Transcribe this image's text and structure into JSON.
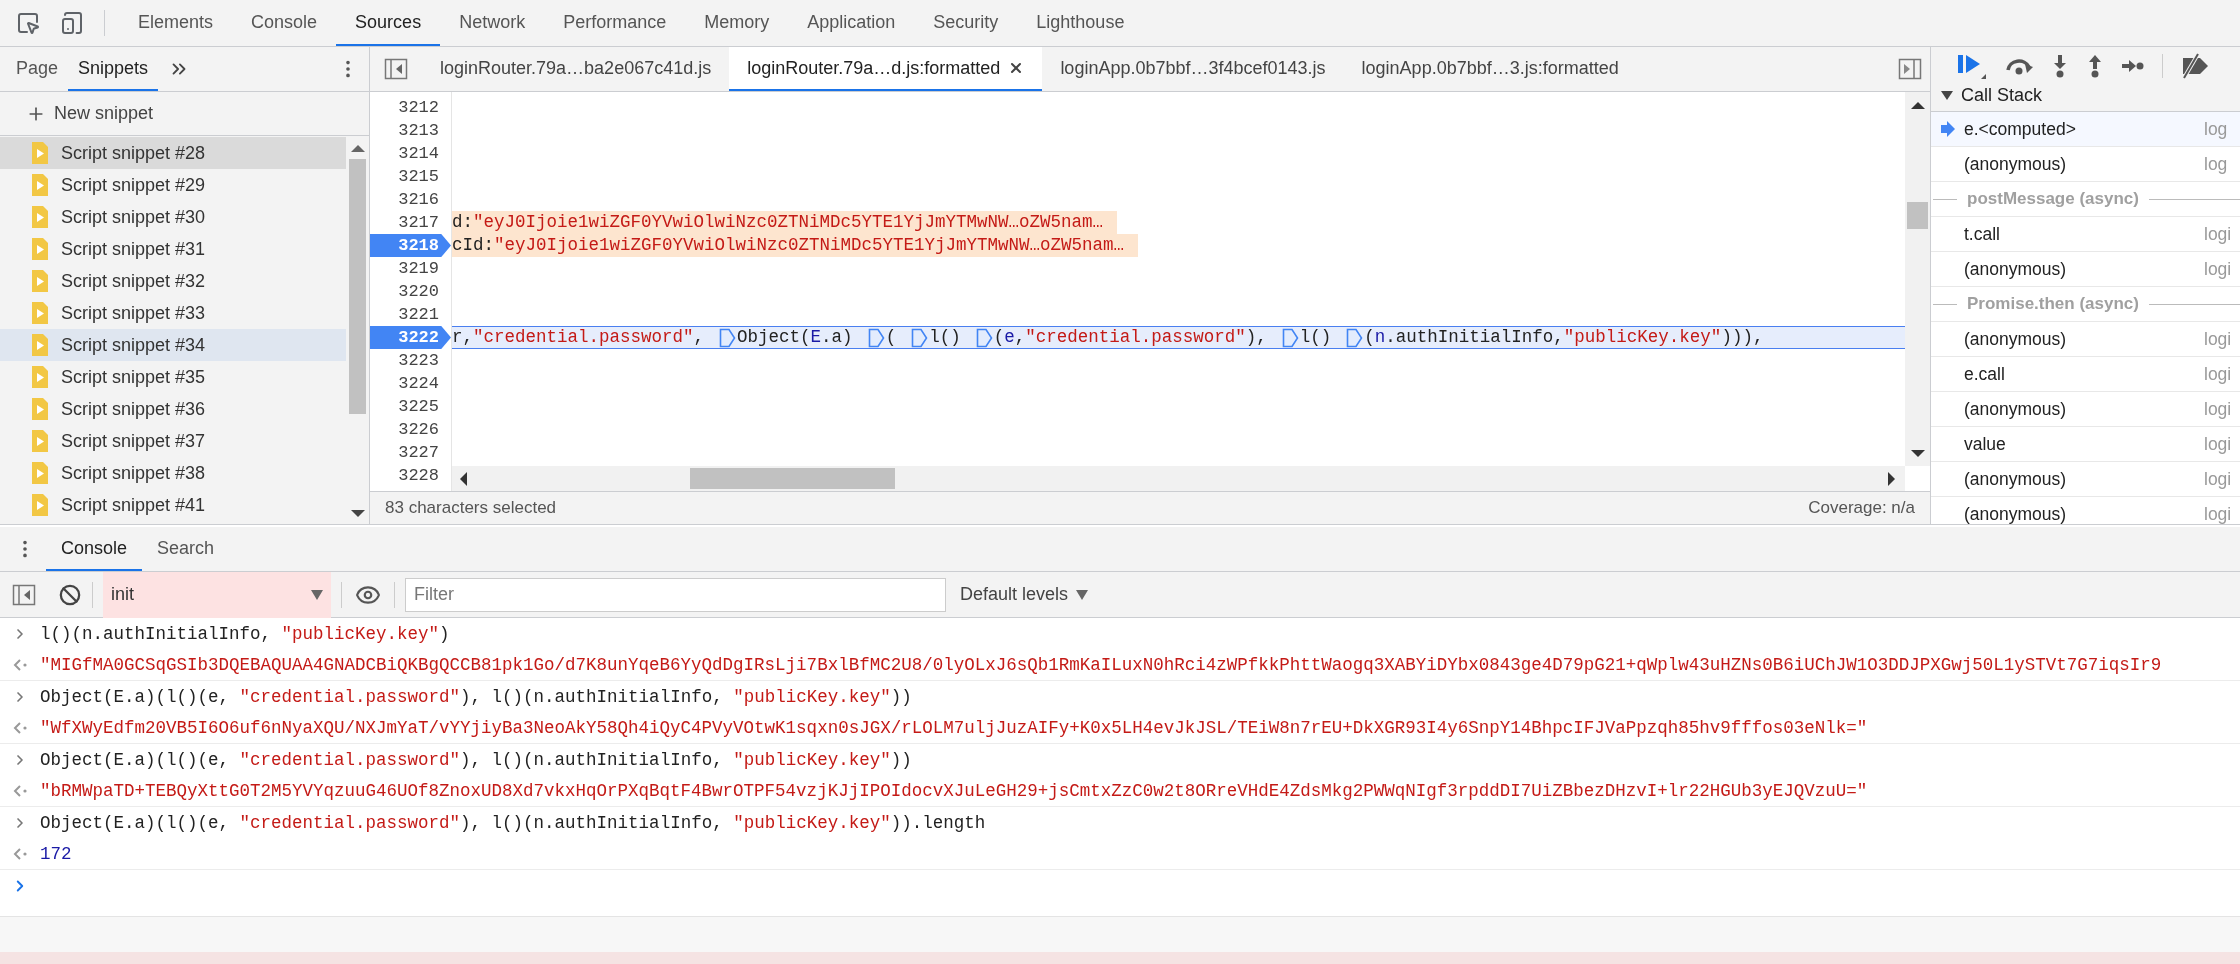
{
  "toolbar": {
    "tabs": [
      {
        "label": "Elements",
        "selected": false
      },
      {
        "label": "Console",
        "selected": false
      },
      {
        "label": "Sources",
        "selected": true
      },
      {
        "label": "Network",
        "selected": false
      },
      {
        "label": "Performance",
        "selected": false
      },
      {
        "label": "Memory",
        "selected": false
      },
      {
        "label": "Application",
        "selected": false
      },
      {
        "label": "Security",
        "selected": false
      },
      {
        "label": "Lighthouse",
        "selected": false
      }
    ]
  },
  "navigator": {
    "tabs": [
      {
        "label": "Page",
        "selected": false
      },
      {
        "label": "Snippets",
        "selected": true
      }
    ],
    "new_snippet": "New snippet",
    "snippets": [
      {
        "label": "Script snippet #28",
        "selected": false,
        "hovered": true
      },
      {
        "label": "Script snippet #29",
        "selected": false,
        "hovered": false
      },
      {
        "label": "Script snippet #30",
        "selected": false,
        "hovered": false
      },
      {
        "label": "Script snippet #31",
        "selected": false,
        "hovered": false
      },
      {
        "label": "Script snippet #32",
        "selected": false,
        "hovered": false
      },
      {
        "label": "Script snippet #33",
        "selected": false,
        "hovered": false
      },
      {
        "label": "Script snippet #34",
        "selected": true,
        "hovered": false
      },
      {
        "label": "Script snippet #35",
        "selected": false,
        "hovered": false
      },
      {
        "label": "Script snippet #36",
        "selected": false,
        "hovered": false
      },
      {
        "label": "Script snippet #37",
        "selected": false,
        "hovered": false
      },
      {
        "label": "Script snippet #38",
        "selected": false,
        "hovered": false
      },
      {
        "label": "Script snippet #41",
        "selected": false,
        "hovered": false
      }
    ]
  },
  "editor": {
    "tabs": [
      {
        "label": "loginRouter.79a…ba2e067c41d.js",
        "selected": false,
        "closable": false
      },
      {
        "label": "loginRouter.79a…d.js:formatted",
        "selected": true,
        "closable": true
      },
      {
        "label": "loginApp.0b7bbf…3f4bcef0143.js",
        "selected": false,
        "closable": false
      },
      {
        "label": "loginApp.0b7bbf…3.js:formatted",
        "selected": false,
        "closable": false
      }
    ],
    "lines": [
      {
        "number": "3212",
        "breakpoint": false,
        "paused": false
      },
      {
        "number": "3213",
        "breakpoint": false,
        "paused": false
      },
      {
        "number": "3214",
        "breakpoint": false,
        "paused": false
      },
      {
        "number": "3215",
        "breakpoint": false,
        "paused": false
      },
      {
        "number": "3216",
        "breakpoint": false,
        "paused": false
      },
      {
        "number": "3217",
        "breakpoint": false,
        "paused": false,
        "highlighted": true,
        "tokens": [
          {
            "kind": "plain",
            "text": "d: "
          },
          {
            "kind": "string",
            "text": "\"eyJ0Ijoie1wiZGF0YVwiOlwiNzc0ZTNiMDc5YTE1YjJmYTMwNW…oZW5nam…"
          }
        ]
      },
      {
        "number": "3218",
        "breakpoint": true,
        "paused": false,
        "highlighted": true,
        "tokens": [
          {
            "kind": "plain",
            "text": "cId: "
          },
          {
            "kind": "string",
            "text": "\"eyJ0Ijoie1wiZGF0YVwiOlwiNzc0ZTNiMDc5YTE1YjJmYTMwNW…oZW5nam…"
          }
        ]
      },
      {
        "number": "3219",
        "breakpoint": false,
        "paused": false
      },
      {
        "number": "3220",
        "breakpoint": false,
        "paused": false
      },
      {
        "number": "3221",
        "breakpoint": false,
        "paused": false
      },
      {
        "number": "3222",
        "breakpoint": true,
        "paused": true,
        "highlighted": false,
        "tokens": [
          {
            "kind": "plain",
            "text": "r, "
          },
          {
            "kind": "string",
            "text": "\"credential.password\""
          },
          {
            "kind": "plain",
            "text": ", "
          },
          {
            "kind": "marker"
          },
          {
            "kind": "plain",
            "text": "Object("
          },
          {
            "kind": "var",
            "text": "E"
          },
          {
            "kind": "plain",
            "text": ".a)"
          },
          {
            "kind": "marker"
          },
          {
            "kind": "plain",
            "text": "("
          },
          {
            "kind": "marker"
          },
          {
            "kind": "plain",
            "text": "l()"
          },
          {
            "kind": "marker"
          },
          {
            "kind": "plain",
            "text": "("
          },
          {
            "kind": "var",
            "text": "e"
          },
          {
            "kind": "plain",
            "text": ", "
          },
          {
            "kind": "string",
            "text": "\"credential.password\""
          },
          {
            "kind": "plain",
            "text": "), "
          },
          {
            "kind": "marker"
          },
          {
            "kind": "plain",
            "text": "l()"
          },
          {
            "kind": "marker"
          },
          {
            "kind": "plain",
            "text": "("
          },
          {
            "kind": "var",
            "text": "n"
          },
          {
            "kind": "plain",
            "text": ".authInitialInfo, "
          },
          {
            "kind": "string",
            "text": "\"publicKey.key\""
          },
          {
            "kind": "plain",
            "text": "))),"
          }
        ]
      },
      {
        "number": "3223",
        "breakpoint": false,
        "paused": false
      },
      {
        "number": "3224",
        "breakpoint": false,
        "paused": false
      },
      {
        "number": "3225",
        "breakpoint": false,
        "paused": false
      },
      {
        "number": "3226",
        "breakpoint": false,
        "paused": false
      },
      {
        "number": "3227",
        "breakpoint": false,
        "paused": false
      },
      {
        "number": "3228",
        "breakpoint": false,
        "paused": false
      }
    ],
    "status": "83 characters selected",
    "coverage": "Coverage: n/a"
  },
  "debugger": {
    "call_stack": {
      "title": "Call Stack",
      "expanded": true,
      "frames": [
        {
          "kind": "frame",
          "name": "e.<computed>",
          "location": "log",
          "selected": true
        },
        {
          "kind": "frame",
          "name": "(anonymous)",
          "location": "log",
          "selected": false
        },
        {
          "kind": "async",
          "name": "postMessage (async)",
          "selected": false
        },
        {
          "kind": "frame",
          "name": "t.call",
          "location": "logi",
          "selected": false
        },
        {
          "kind": "frame",
          "name": "(anonymous)",
          "location": "logi",
          "selected": false
        },
        {
          "kind": "async",
          "name": "Promise.then (async)",
          "selected": false
        },
        {
          "kind": "frame",
          "name": "(anonymous)",
          "location": "logi",
          "selected": false
        },
        {
          "kind": "frame",
          "name": "e.call",
          "location": "logi",
          "selected": false
        },
        {
          "kind": "frame",
          "name": "(anonymous)",
          "location": "logi",
          "selected": false
        },
        {
          "kind": "frame",
          "name": "value",
          "location": "logi",
          "selected": false
        },
        {
          "kind": "frame",
          "name": "(anonymous)",
          "location": "logi",
          "selected": false
        },
        {
          "kind": "frame",
          "name": "(anonymous)",
          "location": "logi",
          "selected": false
        }
      ]
    }
  },
  "drawer": {
    "tabs": [
      {
        "label": "Console",
        "selected": true
      },
      {
        "label": "Search",
        "selected": false
      }
    ],
    "context": "init",
    "filter": {
      "placeholder": "Filter"
    },
    "levels": "Default levels",
    "messages": [
      {
        "kind": "input",
        "tokens": [
          {
            "kind": "plain",
            "text": "l()(n.authInitialInfo, "
          },
          {
            "kind": "string",
            "text": "\"publicKey.key\""
          },
          {
            "kind": "plain",
            "text": ")"
          }
        ]
      },
      {
        "kind": "output",
        "tokens": [
          {
            "kind": "string",
            "text": "\"MIGfMA0GCSqGSIb3DQEBAQUAA4GNADCBiQKBgQCCB81pk1Go/d7K8unYqeB6YyQdDgIRsLji7BxlBfMC2U8/0lyOLxJ6sQb1RmKaILuxN0hRci4zWPfkkPhttWaogq3XABYiDYbx0843ge4D79pG21+qWplw43uHZNs0B6iUChJW1O3DDJPXGwj50L1ySTVt7G7iqsIr9"
          }
        ]
      },
      {
        "kind": "input",
        "tokens": [
          {
            "kind": "plain",
            "text": "Object(E.a)(l()(e, "
          },
          {
            "kind": "string",
            "text": "\"credential.password\""
          },
          {
            "kind": "plain",
            "text": "), l()(n.authInitialInfo, "
          },
          {
            "kind": "string",
            "text": "\"publicKey.key\""
          },
          {
            "kind": "plain",
            "text": "))"
          }
        ]
      },
      {
        "kind": "output",
        "tokens": [
          {
            "kind": "string",
            "text": "\"WfXWyEdfm20VB5I6O6uf6nNyaXQU/NXJmYaT/vYYjiyBa3NeoAkY58Qh4iQyC4PVyVOtwK1sqxn0sJGX/rLOLM7uljJuzAIFy+K0x5LH4evJkJSL/TEiW8n7rEU+DkXGR93I4y6SnpY14BhpcIFJVaPpzqh85hv9fffos03eNlk=\""
          }
        ]
      },
      {
        "kind": "input",
        "tokens": [
          {
            "kind": "plain",
            "text": "Object(E.a)(l()(e, "
          },
          {
            "kind": "string",
            "text": "\"credential.password\""
          },
          {
            "kind": "plain",
            "text": "), l()(n.authInitialInfo, "
          },
          {
            "kind": "string",
            "text": "\"publicKey.key\""
          },
          {
            "kind": "plain",
            "text": "))"
          }
        ]
      },
      {
        "kind": "output",
        "tokens": [
          {
            "kind": "string",
            "text": "\"bRMWpaTD+TEBQyXttG0T2M5YVYqzuuG46UOf8ZnoxUD8Xd7vkxHqOrPXqBqtF4BwrOTPF54vzjKJjIPOIdocvXJuLeGH29+jsCmtxZzC0w2t8ORreVHdE4ZdsMkg2PWWqNIgf3rpddDI7UiZBbezDHzvI+lr22HGUb3yEJQVzuU=\""
          }
        ]
      },
      {
        "kind": "input",
        "tokens": [
          {
            "kind": "plain",
            "text": "Object(E.a)(l()(e, "
          },
          {
            "kind": "string",
            "text": "\"credential.password\""
          },
          {
            "kind": "plain",
            "text": "), l()(n.authInitialInfo, "
          },
          {
            "kind": "string",
            "text": "\"publicKey.key\""
          },
          {
            "kind": "plain",
            "text": ")).length"
          }
        ]
      },
      {
        "kind": "output",
        "tokens": [
          {
            "kind": "number",
            "text": "172"
          }
        ]
      },
      {
        "kind": "prompt"
      }
    ]
  }
}
